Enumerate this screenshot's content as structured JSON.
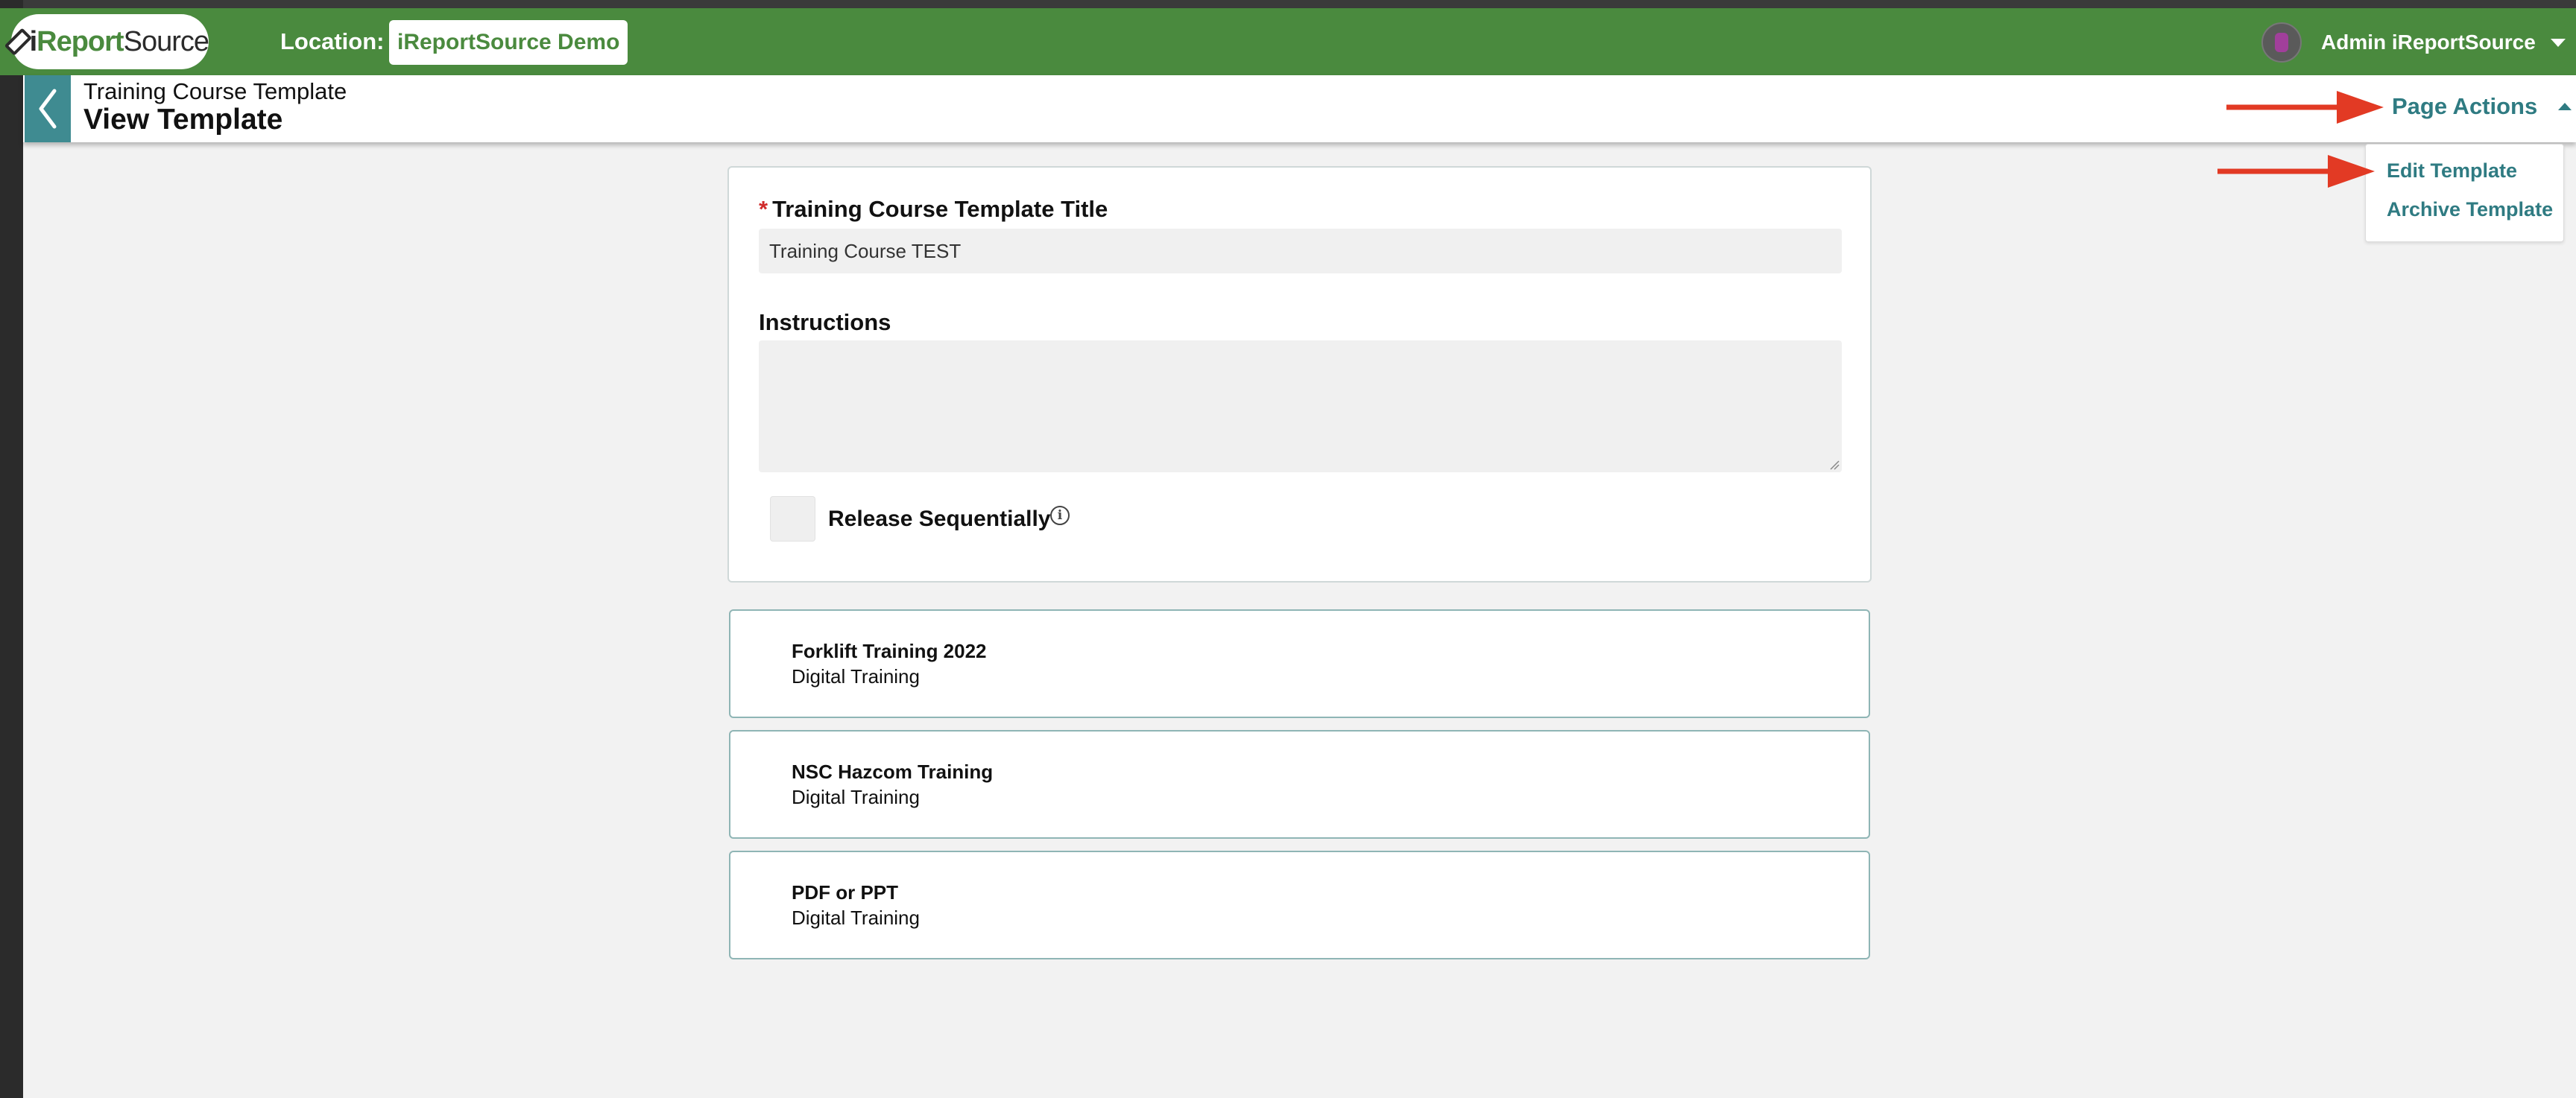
{
  "navbar": {
    "logo": {
      "i": "i",
      "report": "Report",
      "source": "Source"
    },
    "location_label": "Location:",
    "location_value": "iReportSource Demo",
    "user_name": "Admin iReportSource"
  },
  "subheader": {
    "breadcrumb": "Training Course Template",
    "title": "View Template",
    "page_actions_label": "Page Actions"
  },
  "page_actions_menu": {
    "items": [
      {
        "label": "Edit Template"
      },
      {
        "label": "Archive Template"
      }
    ]
  },
  "form": {
    "title_field": {
      "required_marker": "*",
      "label": "Training Course Template Title",
      "value": "Training Course TEST"
    },
    "instructions": {
      "label": "Instructions",
      "value": ""
    },
    "release_sequentially": {
      "label": "Release Sequentially",
      "checked": false,
      "info_glyph": "i"
    }
  },
  "courses": [
    {
      "title": "Forklift Training 2022",
      "type": "Digital Training"
    },
    {
      "title": "NSC Hazcom Training",
      "type": "Digital Training"
    },
    {
      "title": "PDF or PPT",
      "type": "Digital Training"
    }
  ],
  "colors": {
    "navbar_green": "#4a8a3e",
    "teal_accent": "#2f7b82",
    "back_button": "#3f8b91",
    "annotation_red": "#e23a24",
    "background": "#f2f2f2"
  }
}
